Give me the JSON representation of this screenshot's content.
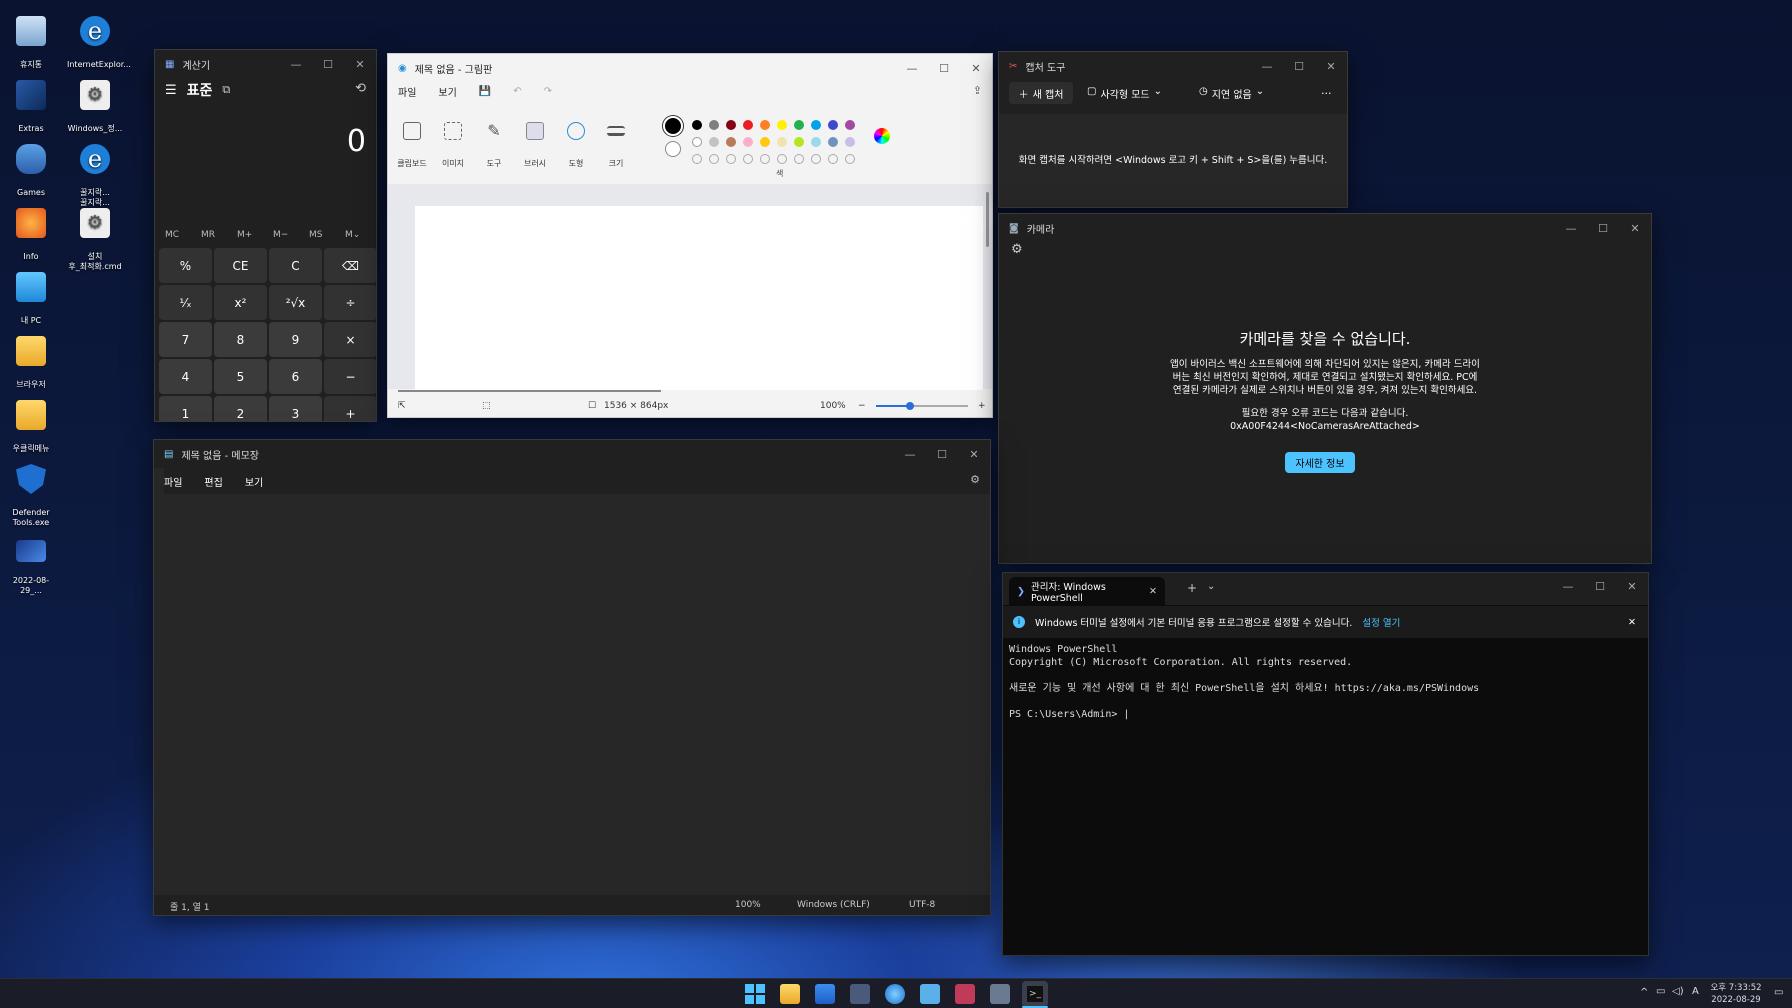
{
  "desktop": {
    "icons": [
      {
        "label": "휴지통",
        "icon": "recycle-bin-icon"
      },
      {
        "label": "InternetExplor...",
        "icon": "internet-explorer-icon"
      },
      {
        "label": "Extras",
        "icon": "extras-icon"
      },
      {
        "label": "Windows_정...",
        "icon": "settings-gear-file-icon"
      },
      {
        "label": "Games",
        "icon": "gamepad-icon"
      },
      {
        "label": "꿀지락...\n꿀지락...",
        "icon": "internet-explorer-icon"
      },
      {
        "label": "Info",
        "icon": "bird-icon"
      },
      {
        "label": "설치\n후_최적화.cmd",
        "icon": "settings-gear-file-icon"
      },
      {
        "label": "내 PC",
        "icon": "monitor-icon"
      },
      {
        "label": "브라우저",
        "icon": "folder-icon"
      },
      {
        "label": "우클릭메뉴",
        "icon": "folder-icon"
      },
      {
        "label": "Defender\nTools.exe",
        "icon": "shield-icon"
      },
      {
        "label": "2022-08-29_...",
        "icon": "image-file-icon"
      }
    ]
  },
  "calculator": {
    "title": "계산기",
    "mode": "표준",
    "display": "0",
    "memory": [
      "MC",
      "MR",
      "M+",
      "M−",
      "MS",
      "M⌄"
    ],
    "keys": [
      "%",
      "CE",
      "C",
      "⌫",
      "¹⁄ₓ",
      "x²",
      "²√x",
      "÷",
      "7",
      "8",
      "9",
      "×",
      "4",
      "5",
      "6",
      "−",
      "1",
      "2",
      "3",
      "+",
      "⁺⁄₋",
      "0",
      ".",
      "="
    ]
  },
  "paint": {
    "title": "제목 없음 - 그림판",
    "menu": [
      "파일",
      "보기"
    ],
    "tools": [
      "클립보드",
      "이미지",
      "도구",
      "브러시",
      "도형",
      "크기"
    ],
    "colors_label": "색",
    "status": {
      "canvas_size": "1536 × 864px",
      "zoom": "100%"
    },
    "palette": [
      "#000000",
      "#7f7f7f",
      "#880015",
      "#ed1c24",
      "#ff7f27",
      "#fff200",
      "#22b14c",
      "#00a2e8",
      "#3f48cc",
      "#a349a4",
      "#ffffff",
      "#c3c3c3",
      "#b97a57",
      "#ffaec9",
      "#ffc90e",
      "#efe4b0",
      "#b5e61d",
      "#99d9ea",
      "#7092be",
      "#c8bfe7"
    ]
  },
  "snip": {
    "title": "캡처 도구",
    "new_button": "새 캡처",
    "mode": "사각형 모드",
    "delay": "지연 없음",
    "more": "...",
    "hint": "화면 캡처를 시작하려면 <Windows 로고 키 + Shift + S>을(를) 누릅니다."
  },
  "camera": {
    "title": "카메라",
    "heading": "카메라를 찾을 수 없습니다.",
    "body1": "앱이 바이러스 백신 소프트웨어에 의해 차단되어 있지는 않은지, 카메라 드라이",
    "body2": "버는 최신 버전인지 확인하여, 제대로 연결되고 설치됐는지 확인하세요. PC에",
    "body3": "연결된 카메라가 실제로 스위치나 버튼이 있을 경우, 켜져 있는지 확인하세요.",
    "code_label": "필요한 경우 오류 코드는 다음과 같습니다.",
    "code": "0xA00F4244<NoCamerasAreAttached>",
    "button": "자세한 정보"
  },
  "notepad": {
    "title": "제목 없음 - 메모장",
    "menu": [
      "파일",
      "편집",
      "보기"
    ],
    "status": {
      "position": "줄 1, 열 1",
      "zoom": "100%",
      "eol": "Windows (CRLF)",
      "encoding": "UTF-8"
    }
  },
  "terminal": {
    "tab_title": "관리자: Windows PowerShell",
    "banner": "Windows 터미널 설정에서 기본 터미널 응용 프로그램으로 설정할 수 있습니다.",
    "banner_link": "설정 열기",
    "lines": [
      "Windows PowerShell",
      "Copyright (C) Microsoft Corporation. All rights reserved.",
      "",
      "새로운 기능 및 개선 사항에 대 한 최신 PowerShell을 설치 하세요! https://aka.ms/PSWindows",
      "",
      "PS C:\\Users\\Admin> |"
    ]
  },
  "taskbar": {
    "time": "오후 7:33:52",
    "date": "2022-08-29",
    "ime": "A",
    "apps": [
      "start-icon",
      "file-explorer-icon",
      "store-icon",
      "calculator-icon",
      "paint-icon",
      "notepad-icon",
      "snipping-tool-icon",
      "camera-icon",
      "terminal-icon"
    ]
  }
}
